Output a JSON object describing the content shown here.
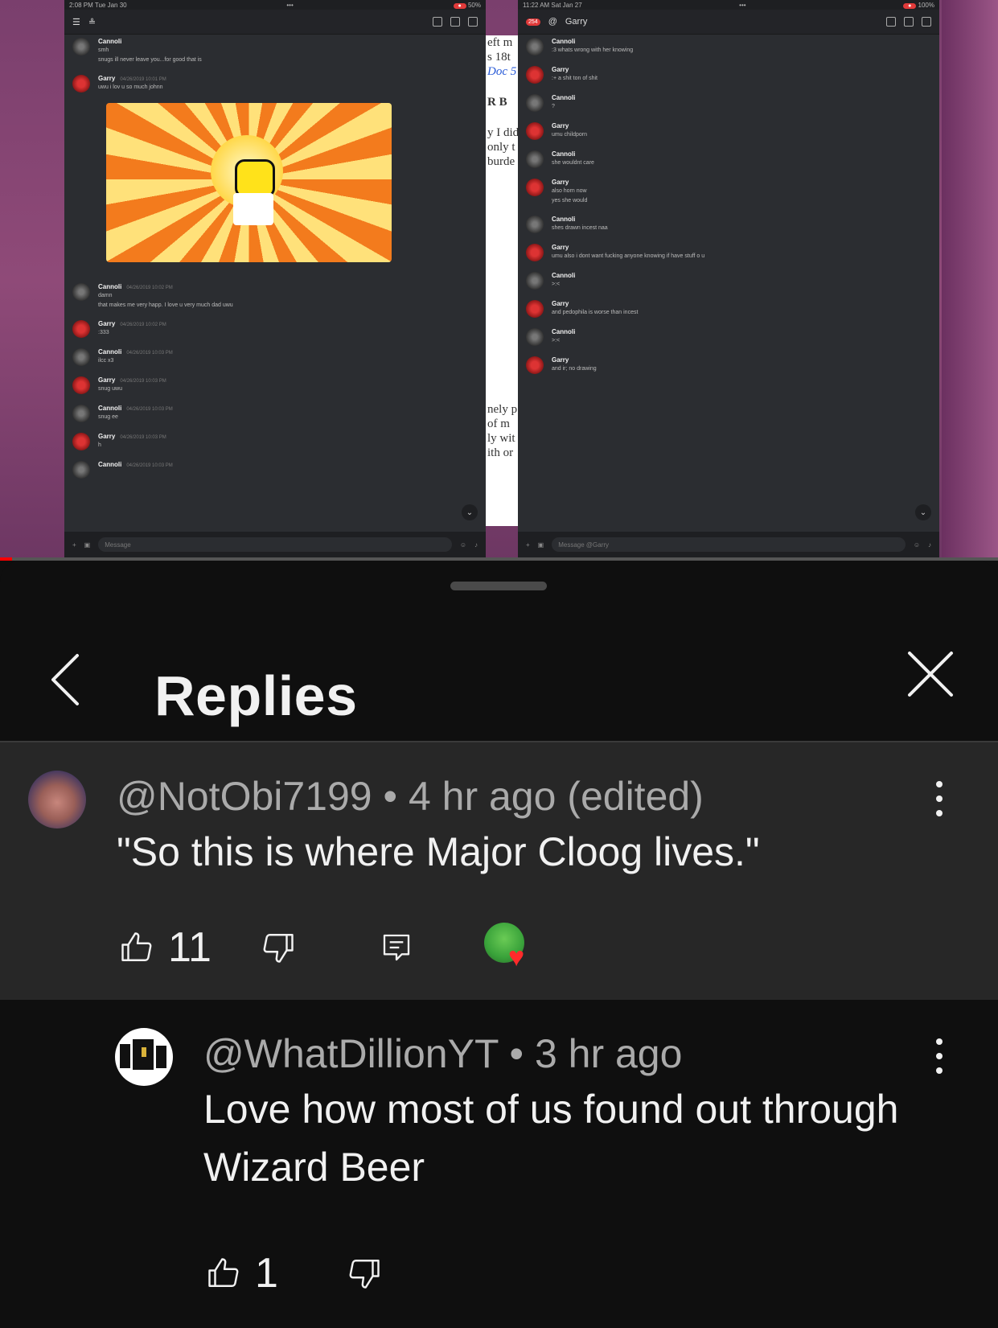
{
  "video": {
    "left_phone": {
      "status_time": "2:08 PM  Tue Jan 30",
      "status_battery": "50%",
      "composer_placeholder": "Message",
      "messages": [
        {
          "author": "Cannoli",
          "time": "",
          "text": "smh"
        },
        {
          "author": "",
          "time": "",
          "text": "snugs ill never leave you...for good that is"
        },
        {
          "author": "Garry",
          "time": "04/26/2019 10:01 PM",
          "text": "uwu i lov u so much johnn"
        },
        {
          "author": "Cannoli",
          "time": "04/26/2019 10:02 PM",
          "text": "damn"
        },
        {
          "author": "",
          "time": "",
          "text": "that makes me very happ. I love u very much dad uwu"
        },
        {
          "author": "Garry",
          "time": "04/26/2019 10:02 PM",
          "text": ":333"
        },
        {
          "author": "Cannoli",
          "time": "04/26/2019 10:03 PM",
          "text": "ilcc x3"
        },
        {
          "author": "Garry",
          "time": "04/26/2019 10:03 PM",
          "text": "snug uwu"
        },
        {
          "author": "Cannoli",
          "time": "04/26/2019 10:03 PM",
          "text": "snug ee"
        },
        {
          "author": "Garry",
          "time": "04/26/2019 10:03 PM",
          "text": "h"
        },
        {
          "author": "Cannoli",
          "time": "04/26/2019 10:03 PM",
          "text": ""
        }
      ]
    },
    "doc_strip": [
      "eft m",
      "s 18t",
      "Doc 5",
      "R B",
      "y I did",
      "only t",
      "burde",
      "nely p",
      "of m",
      "ly wit",
      "ith or"
    ],
    "right_phone": {
      "status_time": "11:22 AM  Sat Jan 27",
      "status_battery": "100%",
      "header_name": "Garry",
      "badge": "254",
      "composer_placeholder": "Message @Garry",
      "messages": [
        {
          "author": "Cannoli",
          "time": "",
          "text": ":3 whats wrong with her knowing"
        },
        {
          "author": "Garry",
          "time": "",
          "text": ":+ a shit ton of shit"
        },
        {
          "author": "Cannoli",
          "time": "",
          "text": "?"
        },
        {
          "author": "Garry",
          "time": "",
          "text": "umu childporn"
        },
        {
          "author": "Cannoli",
          "time": "",
          "text": "she wouldnt care"
        },
        {
          "author": "Garry",
          "time": "",
          "text": "also horn now"
        },
        {
          "author": "",
          "time": "",
          "text": "yes she would"
        },
        {
          "author": "Cannoli",
          "time": "",
          "text": "shes drawn incest naa"
        },
        {
          "author": "Garry",
          "time": "",
          "text": "umu also i dont want fucking anyone knowing if have stuff o u"
        },
        {
          "author": "Cannoli",
          "time": "",
          "text": ">:<"
        },
        {
          "author": "Garry",
          "time": "",
          "text": "and pedophila is worse than incest"
        },
        {
          "author": "Cannoli",
          "time": "",
          "text": ">:<"
        },
        {
          "author": "Garry",
          "time": "",
          "text": "and ir; no drawing"
        }
      ]
    },
    "progress": 0.012
  },
  "sheet": {
    "title": "Replies"
  },
  "comments": [
    {
      "handle": "@NotObi7199",
      "sep": "•",
      "time": "4 hr ago (edited)",
      "text": "\"So this is where Major Cloog lives.\"",
      "likes": "11",
      "creator_hearted": true
    },
    {
      "handle": "@WhatDillionYT",
      "sep": "•",
      "time": "3 hr ago",
      "text": "Love how most of us found out through Wizard Beer",
      "likes": "1"
    }
  ],
  "colors": {
    "sheet_bg": "#0f0f0f",
    "highlight_bg": "#272727",
    "meta_text": "#aaaaaa",
    "body_text": "#f1f1f1"
  }
}
